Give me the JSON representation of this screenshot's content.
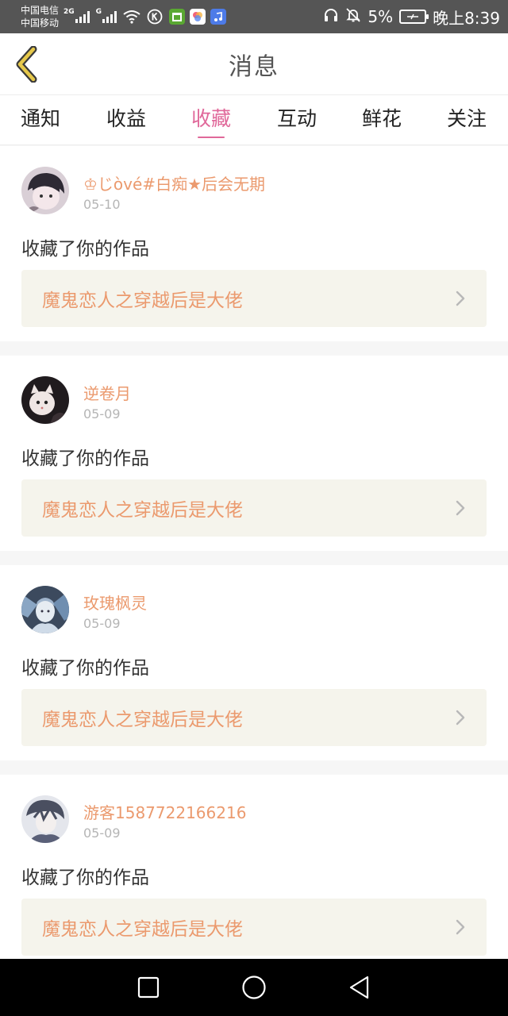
{
  "status_bar": {
    "carrier_1": "中国电信",
    "carrier_2": "中国移动",
    "network_1": "2G",
    "network_2": "G",
    "battery_percent": "5%",
    "time": "晚上8:39"
  },
  "header": {
    "title": "消息"
  },
  "tabs": [
    {
      "label": "通知",
      "active": false
    },
    {
      "label": "收益",
      "active": false
    },
    {
      "label": "收藏",
      "active": true
    },
    {
      "label": "互动",
      "active": false
    },
    {
      "label": "鲜花",
      "active": false
    },
    {
      "label": "关注",
      "active": false
    }
  ],
  "items": [
    {
      "username": "♔じòvé#白痴★后会无期",
      "date": "05-10",
      "action": "收藏了你的作品",
      "work_title": "魔鬼恋人之穿越后是大佬"
    },
    {
      "username": "逆卷月",
      "date": "05-09",
      "action": "收藏了你的作品",
      "work_title": "魔鬼恋人之穿越后是大佬"
    },
    {
      "username": "玫瑰枫灵",
      "date": "05-09",
      "action": "收藏了你的作品",
      "work_title": "魔鬼恋人之穿越后是大佬"
    },
    {
      "username": "游客1587722166216",
      "date": "05-09",
      "action": "收藏了你的作品",
      "work_title": "魔鬼恋人之穿越后是大佬"
    }
  ],
  "colors": {
    "accent": "#e0689a",
    "username": "#eb9a6e",
    "back_arrow": "#e6c84a"
  }
}
